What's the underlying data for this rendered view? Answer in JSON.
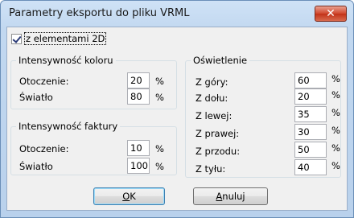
{
  "window": {
    "title": "Parametry eksportu do pliku VRML"
  },
  "checkbox_2d": {
    "label": "z elementami 2D",
    "checked": true
  },
  "group_color": {
    "title": "Intensywność koloru",
    "rows": [
      {
        "label": "Otoczenie:",
        "value": "20",
        "unit": "%"
      },
      {
        "label": "Światło",
        "value": "80",
        "unit": "%"
      }
    ]
  },
  "group_texture": {
    "title": "Intensywność faktury",
    "rows": [
      {
        "label": "Otoczenie:",
        "value": "10",
        "unit": "%"
      },
      {
        "label": "Światło",
        "value": "100",
        "unit": "%"
      }
    ]
  },
  "group_light": {
    "title": "Oświetlenie",
    "rows": [
      {
        "label": "Z góry:",
        "value": "60",
        "unit": "%"
      },
      {
        "label": "Z dołu:",
        "value": "20",
        "unit": "%"
      },
      {
        "label": "Z lewej:",
        "value": "35",
        "unit": "%"
      },
      {
        "label": "Z prawej:",
        "value": "30",
        "unit": "%"
      },
      {
        "label": "Z przodu:",
        "value": "50",
        "unit": "%"
      },
      {
        "label": "Z tyłu:",
        "value": "40",
        "unit": "%"
      }
    ]
  },
  "buttons": {
    "ok": {
      "underlined": "O",
      "rest": "K"
    },
    "cancel": {
      "underlined": "A",
      "rest": "nuluj"
    }
  },
  "icons": {
    "close": "close-icon"
  },
  "colors": {
    "title_bar": "#c2d8f0",
    "close_button": "#c9462c",
    "client_bg": "#f0f0f0"
  }
}
